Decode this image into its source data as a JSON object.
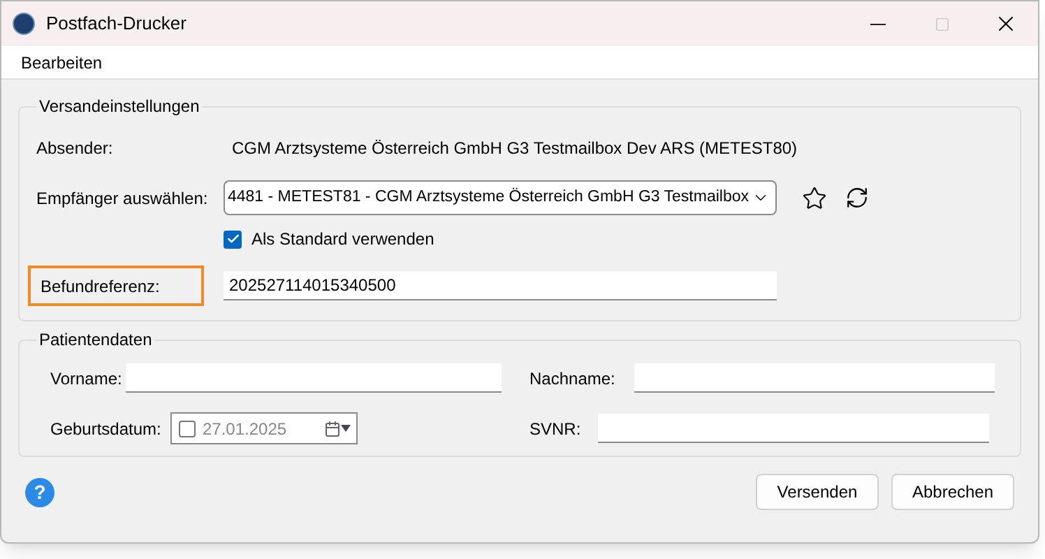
{
  "window": {
    "title": "Postfach-Drucker"
  },
  "menu": [
    "Bearbeiten"
  ],
  "shipping": {
    "title": "Versandeinstellungen",
    "sender_label": "Absender:",
    "sender": "CGM Arztsysteme Österreich GmbH G3 Testmailbox Dev ARS (METEST80)",
    "recipient_label": "Empfänger auswählen:",
    "recipient": "4481 - METEST81 - CGM Arztsysteme Österreich GmbH G3 Testmailbox",
    "default_checkbox": {
      "label": "Als Standard verwenden",
      "checked": true
    },
    "reference_label": "Befundreferenz:",
    "reference_highlighted": true,
    "reference": "202527114015340500"
  },
  "patient": {
    "title": "Patientendaten",
    "first_name_label": "Vorname:",
    "last_name_label": "Nachname:",
    "birthdate_label": "Geburtsdatum:",
    "birthdate": {
      "checked": false,
      "value": "27.01.2025"
    },
    "svnr_label": "SVNR:"
  },
  "help": "?",
  "buttons": [
    "Versenden",
    "Abbrechen"
  ]
}
